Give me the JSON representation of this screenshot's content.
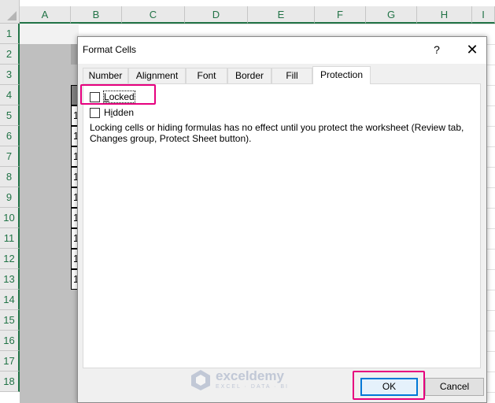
{
  "sheet": {
    "columns": [
      "A",
      "B",
      "C",
      "D",
      "E",
      "F",
      "G",
      "H",
      "I"
    ],
    "rows": [
      "1",
      "2",
      "3",
      "4",
      "5",
      "6",
      "7",
      "8",
      "9",
      "10",
      "11",
      "12",
      "13",
      "14",
      "15",
      "16",
      "17",
      "18"
    ],
    "visible_cells": [
      "1",
      "1",
      "1",
      "1",
      "1",
      "1",
      "1",
      "1",
      "1"
    ],
    "accent_color": "#217346"
  },
  "dialog": {
    "title": "Format Cells",
    "help_label": "?",
    "close_label": "✕",
    "tabs": [
      {
        "label": "Number"
      },
      {
        "label": "Alignment"
      },
      {
        "label": "Font"
      },
      {
        "label": "Border"
      },
      {
        "label": "Fill"
      },
      {
        "label": "Protection"
      }
    ],
    "active_tab": "Protection",
    "locked": {
      "label_first": "L",
      "label_rest": "ocked",
      "checked": false
    },
    "hidden": {
      "label_first": "H",
      "label_mid": "i",
      "label_rest": "dden",
      "checked": false
    },
    "description": "Locking cells or hiding formulas has no effect until you protect the worksheet (Review tab, Changes group, Protect Sheet button).",
    "ok_label": "OK",
    "cancel_label": "Cancel",
    "highlight_color": "#e6007e"
  },
  "watermark": {
    "name": "exceldemy",
    "tagline": "EXCEL · DATA · BI"
  }
}
